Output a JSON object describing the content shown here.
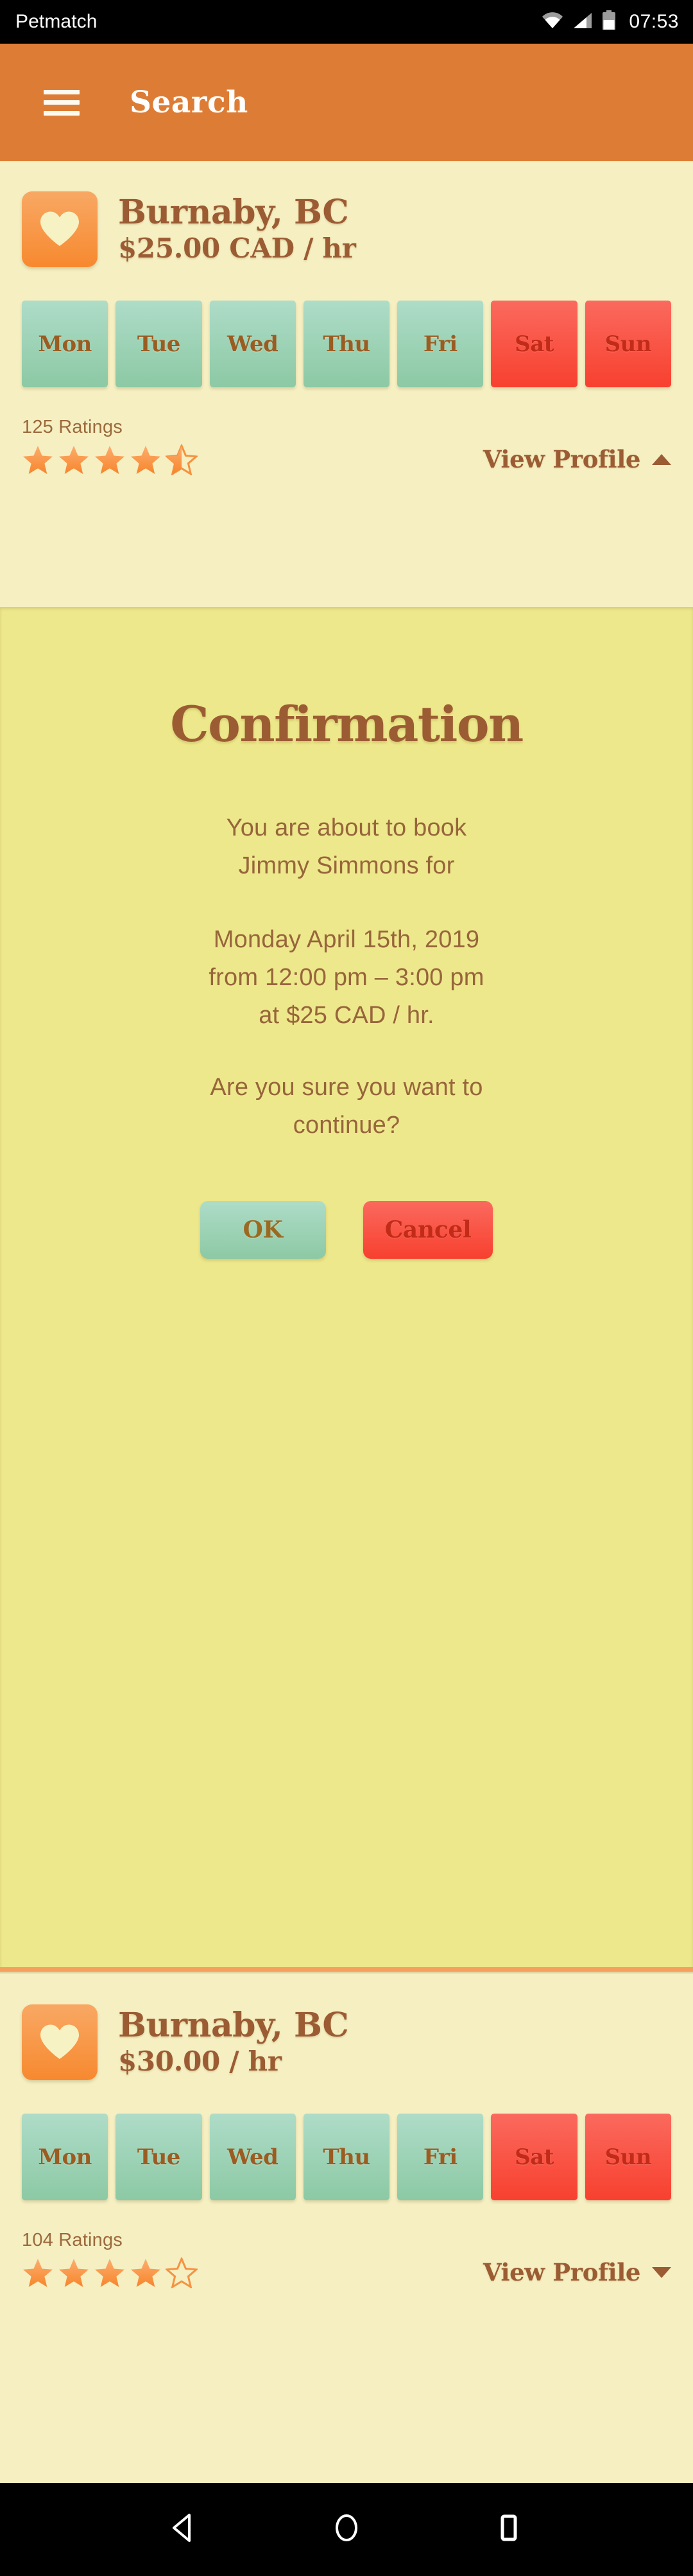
{
  "status_bar": {
    "app_name": "Petmatch",
    "time": "07:53",
    "icons": [
      "wifi-icon",
      "cellular-signal-icon",
      "battery-icon"
    ]
  },
  "app_bar": {
    "menu_icon": "hamburger-menu-icon",
    "title": "Search"
  },
  "colors": {
    "accent_orange": "#dd7d35",
    "card_bg": "#f5efc2",
    "panel_bg": "#eee88c",
    "brown_text": "#9c5c33",
    "available_green": "#8cc9a4",
    "busy_red": "#f8402f",
    "star_orange": "#f79241",
    "divider_orange": "#f5a05c"
  },
  "listings": [
    {
      "favorite_icon": "heart-icon",
      "location": "Burnaby, BC",
      "price": "$25.00 CAD / hr",
      "days": [
        {
          "label": "Mon",
          "state": "avail"
        },
        {
          "label": "Tue",
          "state": "avail"
        },
        {
          "label": "Wed",
          "state": "avail"
        },
        {
          "label": "Thu",
          "state": "avail"
        },
        {
          "label": "Fri",
          "state": "avail"
        },
        {
          "label": "Sat",
          "state": "busy"
        },
        {
          "label": "Sun",
          "state": "busy"
        }
      ],
      "ratings_count": "125 Ratings",
      "rating_value": 4.5,
      "stars": [
        "full",
        "full",
        "full",
        "full",
        "half"
      ],
      "view_profile_label": "View Profile",
      "view_profile_caret": "chevron-up-icon",
      "expanded": true
    },
    {
      "favorite_icon": "heart-icon",
      "location": "Burnaby, BC",
      "price": "$30.00 / hr",
      "days": [
        {
          "label": "Mon",
          "state": "avail"
        },
        {
          "label": "Tue",
          "state": "avail"
        },
        {
          "label": "Wed",
          "state": "avail"
        },
        {
          "label": "Thu",
          "state": "avail"
        },
        {
          "label": "Fri",
          "state": "avail"
        },
        {
          "label": "Sat",
          "state": "busy"
        },
        {
          "label": "Sun",
          "state": "busy"
        }
      ],
      "ratings_count": "104 Ratings",
      "rating_value": 4.0,
      "stars": [
        "full",
        "full",
        "full",
        "full",
        "empty"
      ],
      "view_profile_label": "View Profile",
      "view_profile_caret": "chevron-down-icon",
      "expanded": false
    }
  ],
  "confirmation": {
    "title": "Confirmation",
    "line_1": "You are about to book",
    "line_2": "Jimmy Simmons for",
    "line_3": "Monday April 15th, 2019",
    "line_4": "from 12:00 pm – 3:00 pm",
    "line_5": "at $25 CAD / hr.",
    "line_6": "Are you sure you want to",
    "line_7": "continue?",
    "ok_label": "OK",
    "cancel_label": "Cancel"
  },
  "nav_bar": {
    "back_label": "back-button",
    "home_label": "home-button",
    "recents_label": "recents-button"
  }
}
